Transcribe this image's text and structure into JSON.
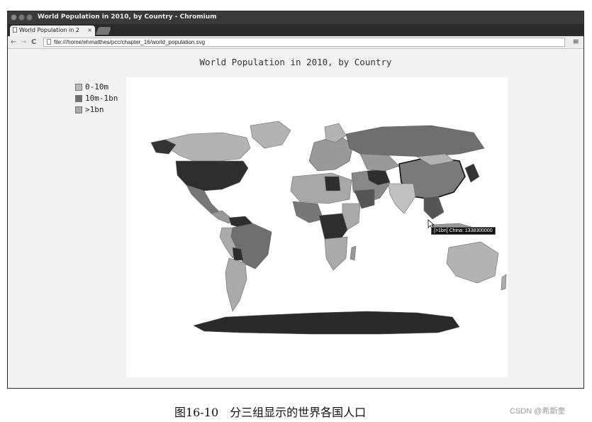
{
  "window": {
    "title": "World Population in 2010, by Country - Chromium",
    "tab_label": "World Population in 2",
    "tab_close": "×",
    "url": "file:///home/ehmatthes/pcc/chapter_16/world_population.svg",
    "menu_icon": "≡"
  },
  "chart_data": {
    "type": "choropleth",
    "title": "World Population in 2010, by Country",
    "legend": [
      {
        "label": "0-10m",
        "color": "#b9b9b9"
      },
      {
        "label": "10m-1bn",
        "color": "#6f6f6f"
      },
      {
        "label": ">1bn",
        "color": "#a9a9a9"
      }
    ],
    "legend_placement": "top-left",
    "tooltip": {
      "group": "[>1bn]",
      "country": "China",
      "value": 1338300000
    },
    "tooltip_text": "[>1bn] China: 1338300000"
  },
  "colors": {
    "high_band": "#333333",
    "dark_region": "#2a2a2a",
    "mid_region": "#7a7a7a",
    "light_region": "#b9b9b9"
  },
  "caption": "图16-10　分三组显示的世界各国人口",
  "watermark": "CSDN @希斯奎"
}
